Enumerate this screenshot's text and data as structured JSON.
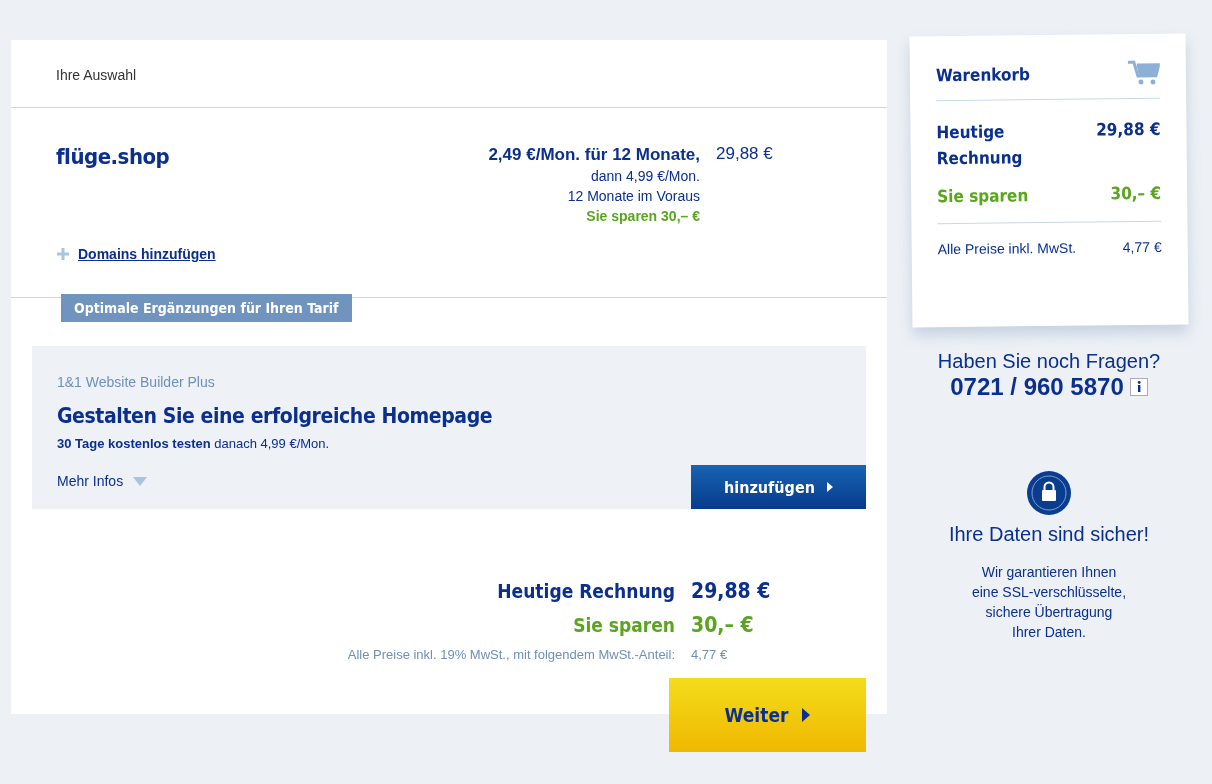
{
  "selection": {
    "heading": "Ihre Auswahl",
    "product": {
      "name": "flüge.shop",
      "price_main": "2,49 €/Mon. für 12 Monate,",
      "price_after": "dann 4,99 €/Mon.",
      "billing": "12 Monate im Voraus",
      "savings": "Sie sparen 30,– €",
      "total": "29,88 €"
    },
    "add_domains": "Domains hinzufügen"
  },
  "addons": {
    "tab": "Optimale Ergänzungen für Ihren Tarif",
    "items": [
      {
        "product": "1&1 Website Builder Plus",
        "title": "Gestalten Sie eine erfolgreiche Homepage",
        "offer": "**30 Tage kostenlos testen** danach 4,99 €/Mon.",
        "more": "Mehr Infos",
        "expanded": false,
        "button": "hinzufügen"
      }
    ]
  },
  "summary": {
    "rows": [
      {
        "kind": "total",
        "label": "Heutige Rechnung",
        "value": "29,88 €"
      },
      {
        "kind": "savings",
        "label": "Sie sparen",
        "value": "30,– €"
      },
      {
        "kind": "tax",
        "label": "Alle Preise inkl. 19% MwSt., mit folgendem MwSt.-Anteil:",
        "value": "4,77 €"
      }
    ],
    "button": "Weiter"
  },
  "cart": {
    "title": "Warenkorb",
    "rows": [
      {
        "kind": "total",
        "label": "Heutige Rechnung",
        "value": "29,88 €"
      },
      {
        "kind": "savings",
        "label": "Sie sparen",
        "value": "30,– €"
      },
      {
        "kind": "tax",
        "label": "Alle Preise inkl. MwSt.",
        "value": "4,77 €"
      }
    ]
  },
  "contact": {
    "question": "Haben Sie noch Fragen?",
    "phone": "0721 / 960 5870"
  },
  "security": {
    "title": "Ihre Daten sind sicher!",
    "lines": [
      "Wir garantieren Ihnen",
      "eine SSL-verschlüsselte,",
      "sichere Übertragung",
      "Ihrer Daten."
    ]
  }
}
